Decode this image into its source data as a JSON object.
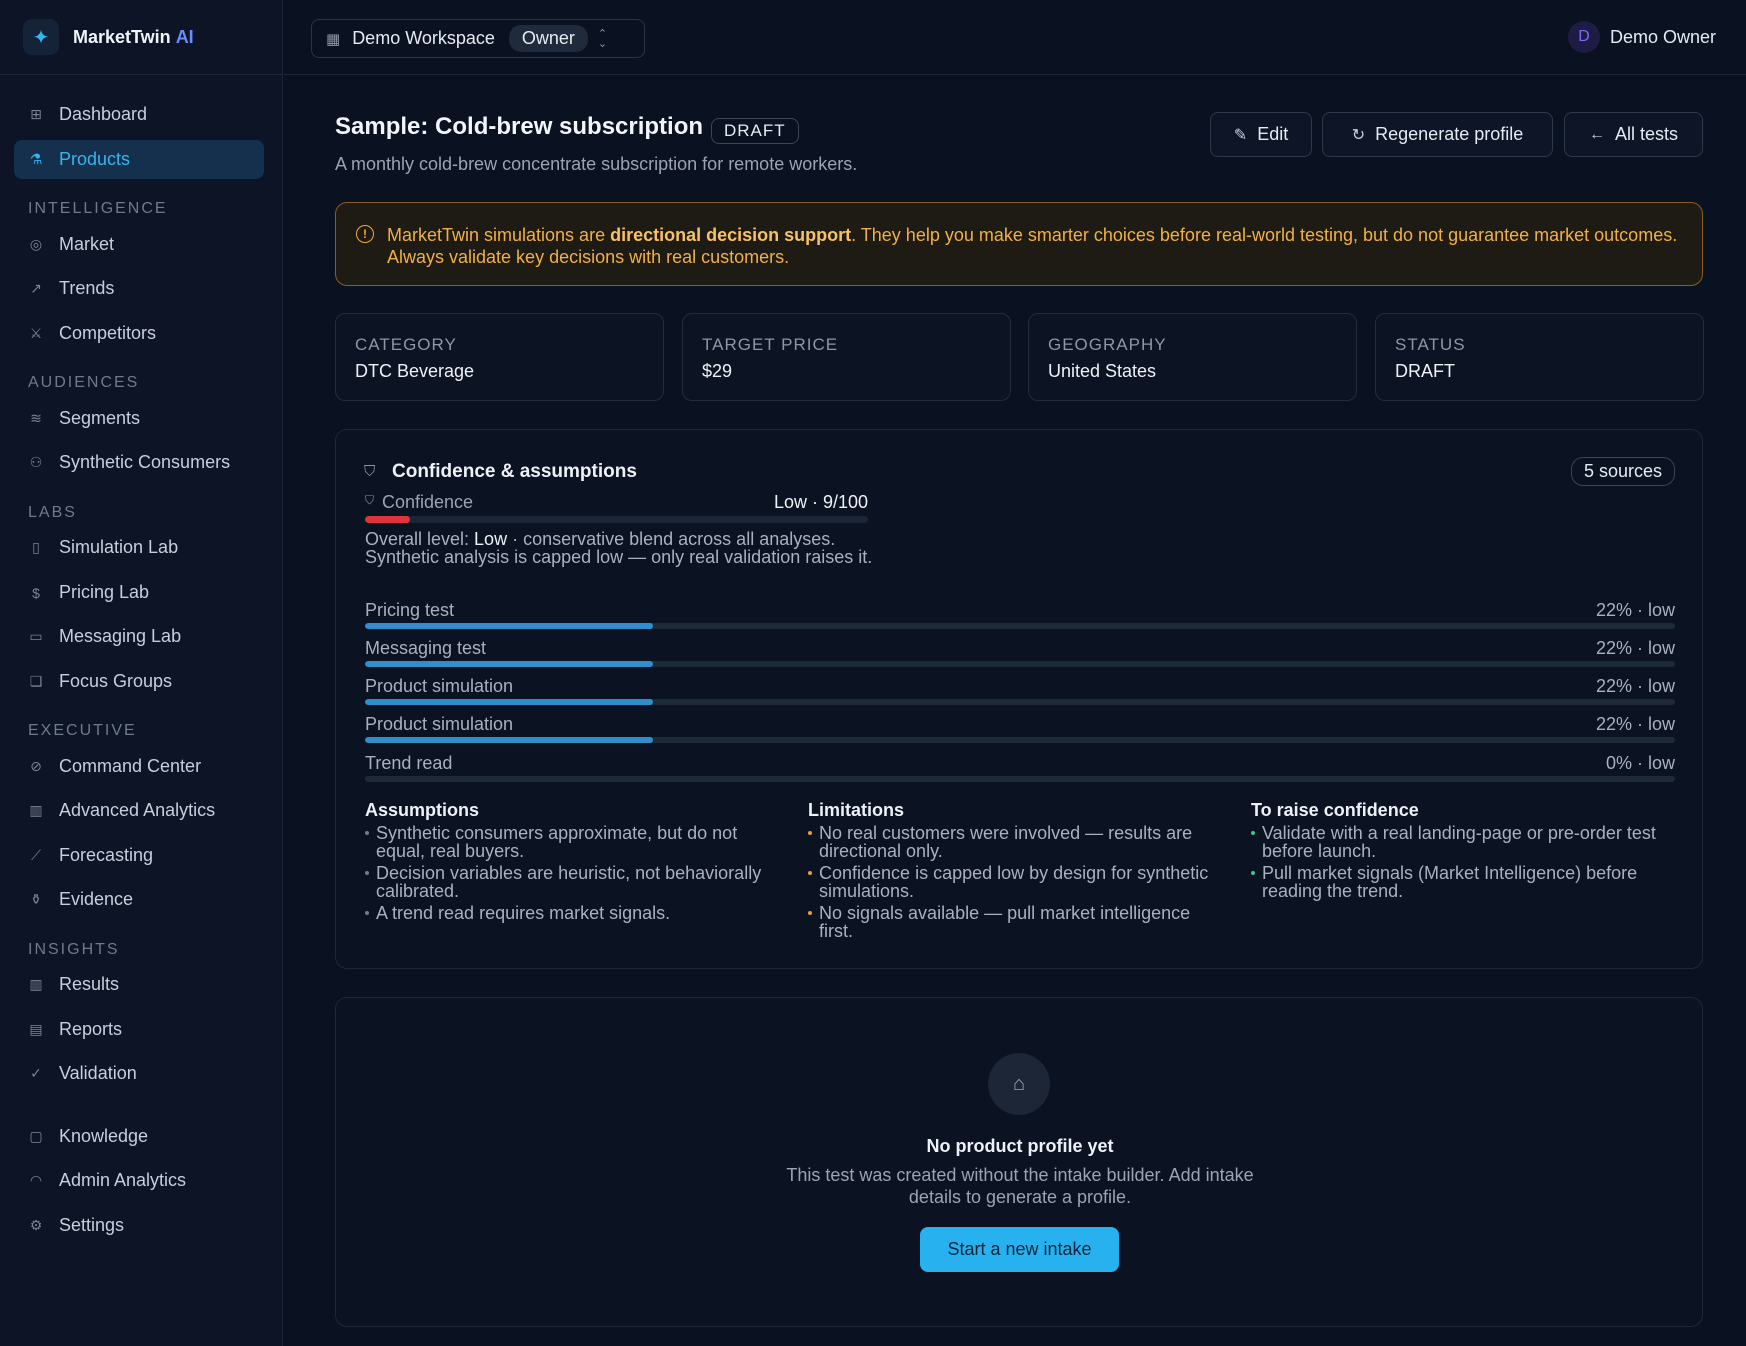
{
  "brand": {
    "name": "MarketTwin",
    "suffix": "AI"
  },
  "workspace": {
    "name": "Demo Workspace",
    "role": "Owner"
  },
  "user": {
    "initial": "D",
    "name": "Demo Owner"
  },
  "sidebar": {
    "top": [
      {
        "label": "Dashboard",
        "icon": "grid-icon"
      },
      {
        "label": "Products",
        "icon": "flask-icon",
        "active": true
      }
    ],
    "sections": {
      "intelligence": "INTELLIGENCE",
      "audiences": "AUDIENCES",
      "labs": "LABS",
      "executive": "EXECUTIVE",
      "insights": "INSIGHTS"
    },
    "items": {
      "market": "Market",
      "trends": "Trends",
      "competitors": "Competitors",
      "segments": "Segments",
      "synthetic": "Synthetic Consumers",
      "simulation": "Simulation Lab",
      "pricing": "Pricing Lab",
      "messaging": "Messaging Lab",
      "focus": "Focus Groups",
      "command": "Command Center",
      "advanced": "Advanced Analytics",
      "forecasting": "Forecasting",
      "evidence": "Evidence",
      "results": "Results",
      "reports": "Reports",
      "validation": "Validation",
      "knowledge": "Knowledge",
      "admin": "Admin Analytics",
      "settings": "Settings"
    }
  },
  "header": {
    "title": "Sample: Cold-brew subscription",
    "badge": "DRAFT",
    "subtitle": "A monthly cold-brew concentrate subscription for remote workers.",
    "edit": "Edit",
    "regenerate": "Regenerate profile",
    "all_tests": "All tests"
  },
  "warning": {
    "pre": "MarketTwin simulations are ",
    "bold": "directional decision support",
    "post": ". They help you make smarter choices before real-world testing, but do not guarantee market outcomes. Always validate key decisions with real customers."
  },
  "stats": [
    {
      "label": "CATEGORY",
      "value": "DTC Beverage"
    },
    {
      "label": "TARGET PRICE",
      "value": "$29"
    },
    {
      "label": "GEOGRAPHY",
      "value": "United States"
    },
    {
      "label": "STATUS",
      "value": "DRAFT"
    }
  ],
  "confidence": {
    "title": "Confidence & assumptions",
    "sources": "5 sources",
    "label": "Confidence",
    "value": "Low · 9/100",
    "score": 9,
    "overall_pre": "Overall level: ",
    "overall_level": "Low",
    "overall_post": " · conservative blend across all analyses. Synthetic analysis is capped low — only real validation raises it.",
    "metrics": [
      {
        "label": "Pricing test",
        "value": "22% · low",
        "pct": 22
      },
      {
        "label": "Messaging test",
        "value": "22% · low",
        "pct": 22
      },
      {
        "label": "Product simulation",
        "value": "22% · low",
        "pct": 22
      },
      {
        "label": "Product simulation",
        "value": "22% · low",
        "pct": 22
      },
      {
        "label": "Trend read",
        "value": "0% · low",
        "pct": 0
      }
    ],
    "assumptions": {
      "title": "Assumptions",
      "items": [
        "Synthetic consumers approximate, but do not equal, real buyers.",
        "Decision variables are heuristic, not behaviorally calibrated.",
        "A trend read requires market signals."
      ]
    },
    "limitations": {
      "title": "Limitations",
      "items": [
        "No real customers were involved — results are directional only.",
        "Confidence is capped low by design for synthetic simulations.",
        "No signals available — pull market intelligence first."
      ]
    },
    "raise": {
      "title": "To raise confidence",
      "items": [
        "Validate with a real landing-page or pre-order test before launch.",
        "Pull market signals (Market Intelligence) before reading the trend."
      ]
    }
  },
  "empty": {
    "title": "No product profile yet",
    "text": "This test was created without the intake builder. Add intake details to generate a profile.",
    "button": "Start a new intake"
  },
  "colors": {
    "accent": "#27b1ef",
    "warning": "#f2b043",
    "danger": "#e0333c",
    "bar": "#2f8fcc"
  }
}
